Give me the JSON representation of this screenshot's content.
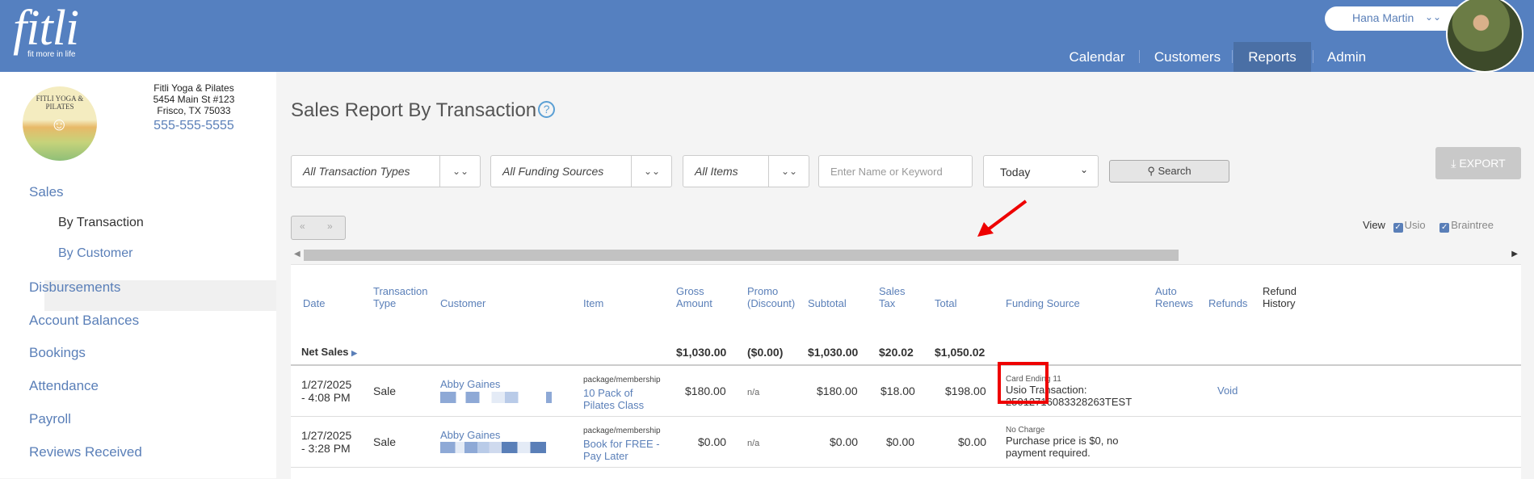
{
  "header": {
    "logo_word": "fitli",
    "logo_tagline": "fit more in life",
    "user_name": "Hana Martin",
    "user_chevron": "⌄⌄",
    "nav": [
      {
        "label": "Calendar",
        "active": false
      },
      {
        "label": "Customers",
        "active": false
      },
      {
        "label": "Reports",
        "active": true
      },
      {
        "label": "Admin",
        "active": false
      }
    ],
    "colors": {
      "bar": "#5580c0",
      "active_tab": "#4a6fa5"
    }
  },
  "org": {
    "logo_text": "FITLI YOGA & PILATES",
    "name_line1": "Fitli Yoga & Pilates",
    "name_line2": "5454 Main St #123",
    "name_line3": "Frisco, TX 75033",
    "phone": "555-555-5555"
  },
  "sidebar": {
    "items": [
      {
        "label": "Sales"
      },
      {
        "label": "By Transaction"
      },
      {
        "label": "By Customer"
      },
      {
        "label": "Disbursements"
      },
      {
        "label": "Account Balances"
      },
      {
        "label": "Bookings"
      },
      {
        "label": "Attendance"
      },
      {
        "label": "Payroll"
      },
      {
        "label": "Reviews Received"
      }
    ]
  },
  "page": {
    "title": "Sales Report By Transaction",
    "help_icon": "?"
  },
  "filters": {
    "transaction_types": "All Transaction Types",
    "funding_sources": "All Funding Sources",
    "items": "All Items",
    "keyword_placeholder": "Enter Name or Keyword",
    "date_range": "Today",
    "search_label": "Search",
    "export_label": "EXPORT",
    "chevron": "⌄⌄"
  },
  "pager": {
    "prev": "«",
    "next": "»"
  },
  "view": {
    "label": "View",
    "options": [
      "Usio",
      "Braintree"
    ]
  },
  "table": {
    "headers": {
      "date": "Date",
      "type_1": "Transaction",
      "type_2": "Type",
      "customer": "Customer",
      "item": "Item",
      "gross_1": "Gross",
      "gross_2": "Amount",
      "promo_1": "Promo",
      "promo_2": "(Discount)",
      "subtotal": "Subtotal",
      "tax_1": "Sales",
      "tax_2": "Tax",
      "total": "Total",
      "funding": "Funding Source",
      "auto_1": "Auto",
      "auto_2": "Renews",
      "refunds": "Refunds",
      "history_1": "Refund",
      "history_2": "History"
    },
    "net_sales": {
      "label": "Net Sales",
      "gross": "$1,030.00",
      "promo": "($0.00)",
      "subtotal": "$1,030.00",
      "tax": "$20.02",
      "total": "$1,050.02"
    },
    "rows": [
      {
        "date_1": "1/27/2025",
        "date_2": "- 4:08 PM",
        "type": "Sale",
        "customer": "Abby Gaines",
        "item_category": "package/membership",
        "item_1": "10 Pack of",
        "item_2": "Pilates Class",
        "gross": "$180.00",
        "promo": "n/a",
        "subtotal": "$180.00",
        "tax": "$18.00",
        "total": "$198.00",
        "funding_small": "Card Ending 11",
        "funding_1": "Usio Transaction:",
        "funding_2": "25012716083328263TEST",
        "refund": "Void"
      },
      {
        "date_1": "1/27/2025",
        "date_2": "- 3:28 PM",
        "type": "Sale",
        "customer": "Abby Gaines",
        "item_category": "package/membership",
        "item_1": "Book for FREE -",
        "item_2": "Pay Later",
        "gross": "$0.00",
        "promo": "n/a",
        "subtotal": "$0.00",
        "tax": "$0.00",
        "total": "$0.00",
        "funding_small": "No Charge",
        "funding_1": "Purchase price is $0, no",
        "funding_2": "payment required.",
        "refund": ""
      }
    ]
  }
}
